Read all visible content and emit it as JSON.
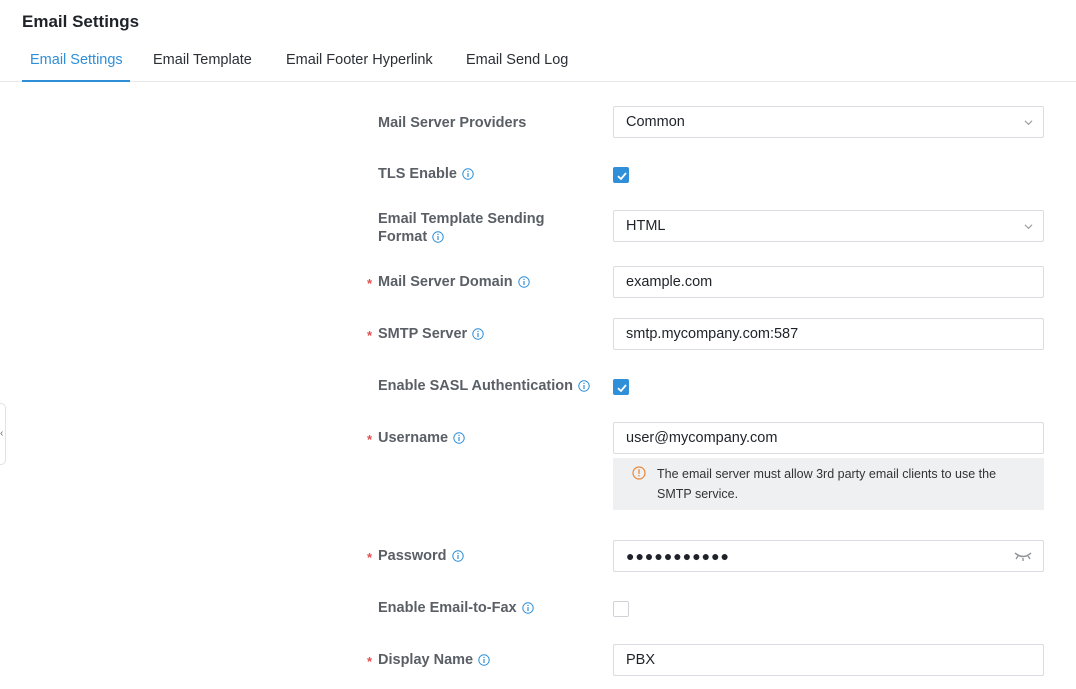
{
  "page": {
    "title": "Email Settings"
  },
  "tabs": [
    {
      "label": "Email Settings",
      "active": true
    },
    {
      "label": "Email Template",
      "active": false
    },
    {
      "label": "Email Footer Hyperlink",
      "active": false
    },
    {
      "label": "Email Send Log",
      "active": false
    }
  ],
  "form": {
    "mail_server_providers": {
      "label": "Mail Server Providers",
      "value": "Common"
    },
    "tls_enable": {
      "label": "TLS Enable",
      "checked": true
    },
    "template_format": {
      "label_line1": "Email Template Sending",
      "label_line2": "Format",
      "value": "HTML"
    },
    "mail_server_domain": {
      "label": "Mail Server Domain",
      "value": "example.com",
      "required": true
    },
    "smtp_server": {
      "label": "SMTP Server",
      "value": "smtp.mycompany.com:587",
      "required": true
    },
    "enable_sasl": {
      "label": "Enable SASL Authentication",
      "checked": true
    },
    "username": {
      "label": "Username",
      "value": "user@mycompany.com",
      "required": true
    },
    "username_notice": "The email server must allow 3rd party email clients to use the SMTP service.",
    "password": {
      "label": "Password",
      "value": "●●●●●●●●●●●",
      "required": true
    },
    "email_to_fax": {
      "label": "Enable Email-to-Fax",
      "checked": false
    },
    "display_name": {
      "label": "Display Name",
      "value": "PBX",
      "required": true
    }
  },
  "required_marker": "*",
  "colors": {
    "accent": "#2f8fd8",
    "required": "#e34d4d",
    "warning": "#e8873a"
  }
}
